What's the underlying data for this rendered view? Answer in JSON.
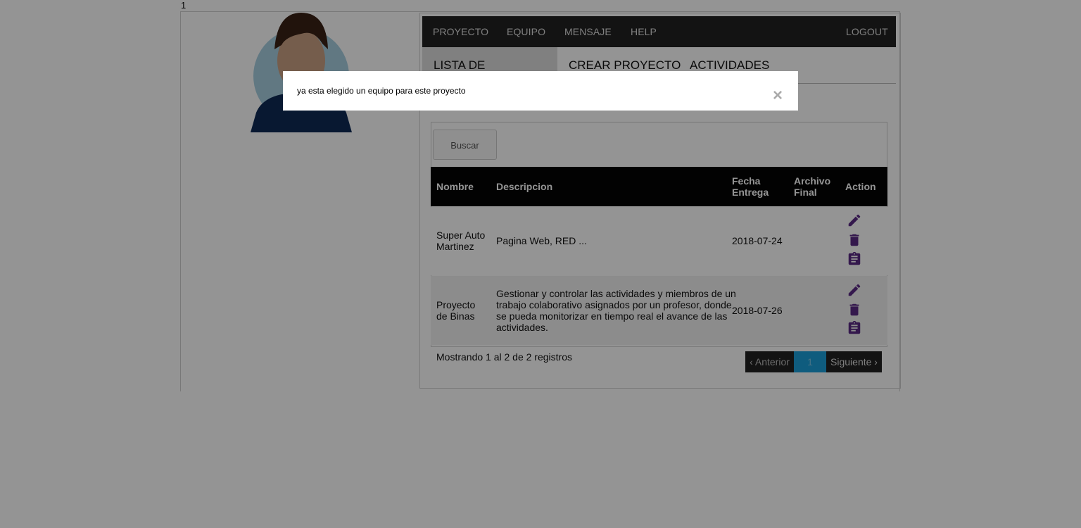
{
  "page_counter": "1",
  "topnav": {
    "items": [
      "PROYECTO",
      "EQUIPO",
      "MENSAJE",
      "HELP"
    ],
    "logout": "LOGOUT"
  },
  "subtabs": [
    "LISTA DE PROYECTO",
    "CREAR PROYECTO",
    "ACTIVIDADES"
  ],
  "search": {
    "label": "Buscar"
  },
  "table": {
    "headers": [
      "Nombre",
      "Descripcion",
      "Fecha Entrega",
      "Archivo Final",
      "Action"
    ],
    "header_lines": {
      "fecha": [
        "Fecha",
        "Entrega"
      ],
      "archivo": [
        "Archivo",
        "Final"
      ]
    },
    "rows": [
      {
        "nombre": [
          "Super Auto",
          "Martinez"
        ],
        "descripcion": [
          "Pagina Web, RED ..."
        ],
        "fecha": "2018-07-24",
        "archivo": ""
      },
      {
        "nombre": [
          "Proyecto",
          "de Binas"
        ],
        "descripcion": [
          "Gestionar y controlar las actividades y miembros de un",
          "trabajo colaborativo asignados por un profesor, donde",
          "se pueda monitorizar en tiempo real el avance de las",
          "actividades."
        ],
        "fecha": "2018-07-26",
        "archivo": ""
      }
    ],
    "action_icons": [
      "pencil-icon",
      "trash-icon",
      "clipboard-icon"
    ],
    "action_color": "#5b2a86"
  },
  "footer": {
    "info": "Mostrando 1 al 2 de 2 registros",
    "prev": "‹ Anterior",
    "current_page": "1",
    "next": "Siguiente ›"
  },
  "modal": {
    "message": "ya esta elegido un equipo para este proyecto",
    "close": "×"
  },
  "colors": {
    "nav_bg": "#222222",
    "table_header_bg": "#050505",
    "pager_active": "#1a9fd9",
    "avatar_shirt": "#0f2a55",
    "avatar_bg": "#a8cfe0"
  }
}
